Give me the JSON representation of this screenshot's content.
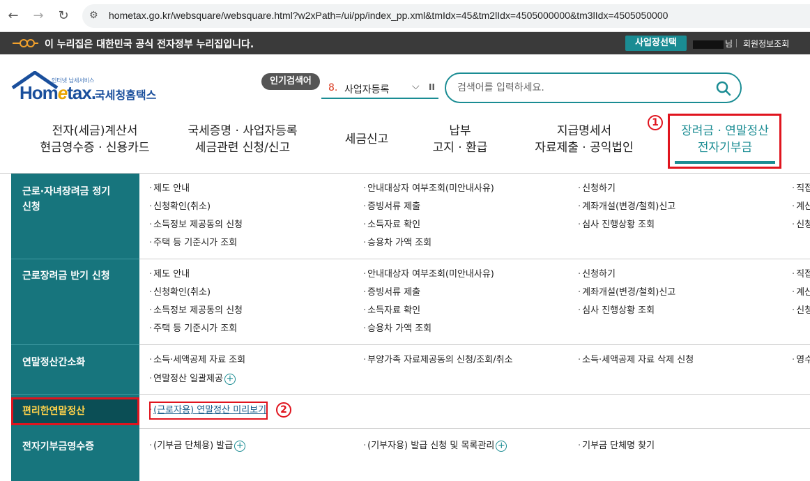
{
  "browser": {
    "url": "hometax.go.kr/websquare/websquare.html?w2xPath=/ui/pp/index_pp.xml&tmIdx=45&tm2lIdx=4505000000&tm3lIdx=4505050000"
  },
  "gov_banner": {
    "text": "이 누리집은 대한민국 공식 전자정부 누리집입니다.",
    "biz_select": "사업장선택",
    "user_suffix": "님",
    "member_info": "회원정보조회"
  },
  "logo": {
    "sub": "인터넷 납세서비스",
    "home_a": "Hom",
    "home_b": "e",
    "home_c": "tax.",
    "nts": "국세청홈택스"
  },
  "popular": {
    "badge": "인기검색어",
    "rank": "8.",
    "keyword": "사업자등록"
  },
  "search": {
    "placeholder": "검색어를 입력하세요."
  },
  "gnb": [
    {
      "line1": "전자(세금)계산서",
      "line2": "현금영수증 · 신용카드"
    },
    {
      "line1": "국세증명 · 사업자등록",
      "line2": "세금관련 신청/신고"
    },
    {
      "line1": "세금신고",
      "line2": ""
    },
    {
      "line1": "납부",
      "line2": "고지 · 환급"
    },
    {
      "line1": "지급명세서",
      "line2": "자료제출 · 공익법인"
    },
    {
      "line1": "장려금 · 연말정산",
      "line2": "전자기부금"
    }
  ],
  "markers": {
    "one": "1",
    "two": "2"
  },
  "menu": {
    "cat1": "근로·자녀장려금 정기",
    "cat1b": "신청",
    "cat2": "근로장려금 반기 신청",
    "cat3": "연말정산간소화",
    "cat4": "편리한연말정산",
    "cat5": "전자기부금영수증",
    "items": {
      "a1": "제도 안내",
      "a2": "안내대상자 여부조회(미안내사유)",
      "a3": "신청하기",
      "a4": "직접",
      "a5": "신청확인(취소)",
      "a6": "증빙서류 제출",
      "a7": "계좌개설(변경/철회)신고",
      "a8": "계산",
      "a9": "소득정보 제공동의 신청",
      "a10": "소득자료 확인",
      "a11": "심사 진행상황 조회",
      "a12": "신청",
      "a13": "주택 등 기준시가 조회",
      "a14": "승용차 가액 조회",
      "b1": "제도 안내",
      "b2": "안내대상자 여부조회(미안내사유)",
      "b3": "신청하기",
      "b4": "직접",
      "b5": "신청확인(취소)",
      "b6": "증빙서류 제출",
      "b7": "계좌개설(변경/철회)신고",
      "b8": "계산",
      "b9": "소득정보 제공동의 신청",
      "b10": "소득자료 확인",
      "b11": "심사 진행상황 조회",
      "b12": "신청",
      "b13": "주택 등 기준시가 조회",
      "b14": "승용차 가액 조회",
      "c1": "소득·세액공제 자료 조회",
      "c2": "부양가족 자료제공동의 신청/조회/취소",
      "c3": "소득·세액공제 자료 삭제 신청",
      "c4": "영수",
      "c5": "연말정산 일괄제공",
      "d1": "(근로자용) 연말정산 미리보기",
      "e1": "(기부금 단체용) 발급",
      "e2": "(기부자용) 발급 신청 및 목록관리",
      "e3": "기부금 단체명 찾기"
    }
  }
}
